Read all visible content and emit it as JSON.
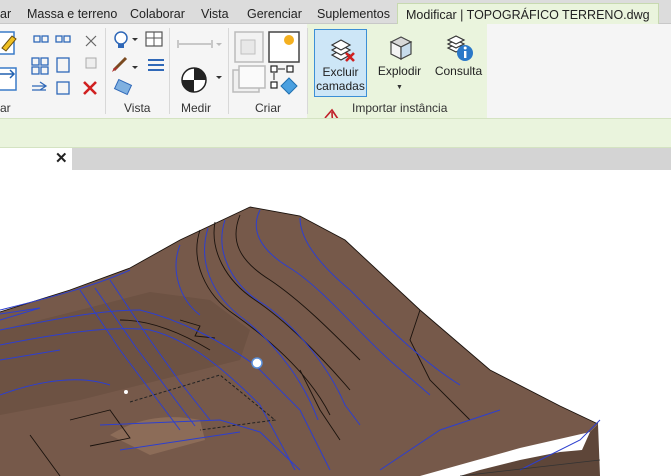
{
  "tabs": [
    {
      "label": "ar"
    },
    {
      "label": "Massa e terreno"
    },
    {
      "label": "Colaborar"
    },
    {
      "label": "Vista"
    },
    {
      "label": "Gerenciar"
    },
    {
      "label": "Suplementos"
    },
    {
      "label": "Modificar | TOPOGRÁFICO TERRENO.dwg"
    }
  ],
  "ribbon": {
    "panels": {
      "modify": "ar",
      "view": "Vista",
      "measure": "Medir",
      "create": "Criar",
      "import_instance": "Importar instância"
    },
    "buttons": {
      "delete_layers_line1": "Excluir",
      "delete_layers_line2": "camadas",
      "explode": "Explodir",
      "query": "Consulta"
    }
  },
  "colors": {
    "terrain": "#7a5c4a",
    "contour": "#2d3fcf",
    "annotation_arrow": "#c0202a",
    "context_tab": "#eaf4dd",
    "selected_border": "#3c8fd6"
  },
  "icons": [
    "close-icon",
    "delete-layers-icon",
    "explode-icon",
    "query-icon",
    "annotation-arrow"
  ]
}
